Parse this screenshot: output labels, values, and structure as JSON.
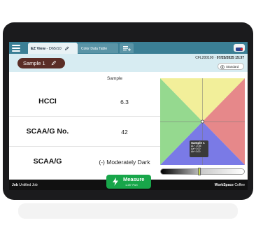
{
  "topbar": {
    "tab_ez_prefix": "EZ View",
    "tab_ez_suffix": " - D65/10",
    "tab_color_data": "Color Data Table"
  },
  "subbar": {
    "sample_label": "Sample 1",
    "instrument": "CFL200100 · ",
    "datetime": "07/25/2025 15:37",
    "standard_label": "Standard"
  },
  "table": {
    "column_header": "Sample",
    "rows": [
      {
        "label": "HCCI",
        "value": "6.3"
      },
      {
        "label": "SCAA/G No.",
        "value": "42"
      },
      {
        "label": "SCAA/G",
        "value": "(-) Moderately Dark"
      }
    ]
  },
  "plot": {
    "tooltip_title": "Sample 1",
    "tooltip_lines": [
      "ΔL* -0.05",
      "Δa* 0.00",
      "Δb* 0.00"
    ],
    "colors": {
      "top": "#f2ef9a",
      "right": "#e6888a",
      "bottom": "#7a7ae6",
      "left": "#95d98f"
    }
  },
  "measure": {
    "label": "Measure",
    "sub": "1.25\" Port"
  },
  "bottombar": {
    "job_key": "Job",
    "job_value": "Untitled Job",
    "ws_key": "WorkSpace",
    "ws_value": "Coffee"
  }
}
